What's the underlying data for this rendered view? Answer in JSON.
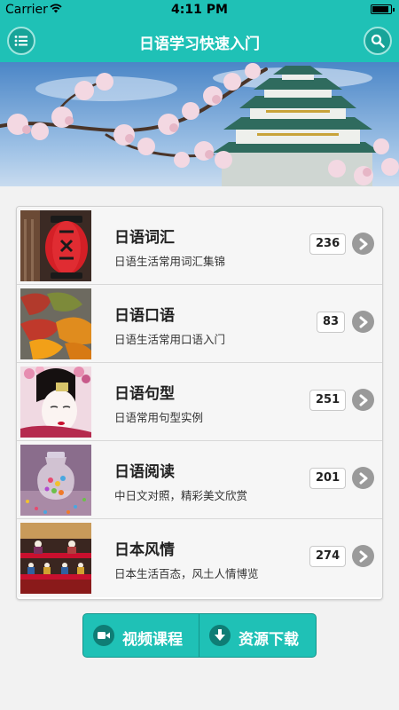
{
  "status_bar": {
    "carrier": "Carrier",
    "time": "4:11 PM",
    "battery_level": 0.8
  },
  "header": {
    "title": "日语学习快速入门",
    "menu_icon": "list-icon",
    "search_icon": "search-icon"
  },
  "banner": {
    "image": "cherry-blossom-osaka-castle"
  },
  "categories": [
    {
      "title": "日语词汇",
      "subtitle": "日语生活常用词汇集锦",
      "count": "236",
      "thumb": "red-lantern"
    },
    {
      "title": "日语口语",
      "subtitle": "日语生活常用口语入门",
      "count": "83",
      "thumb": "autumn-leaves"
    },
    {
      "title": "日语句型",
      "subtitle": "日语常用句型实例",
      "count": "251",
      "thumb": "geisha"
    },
    {
      "title": "日语阅读",
      "subtitle": "中日文对照，精彩美文欣赏",
      "count": "201",
      "thumb": "candy-jar"
    },
    {
      "title": "日本风情",
      "subtitle": "日本生活百态，风土人情博览",
      "count": "274",
      "thumb": "hina-dolls"
    }
  ],
  "buttons": {
    "video_label": "视频课程",
    "download_label": "资源下载"
  },
  "colors": {
    "accent": "#1fc1b6",
    "accent_dark": "#14958b",
    "chevron": "#9a9a9a"
  }
}
